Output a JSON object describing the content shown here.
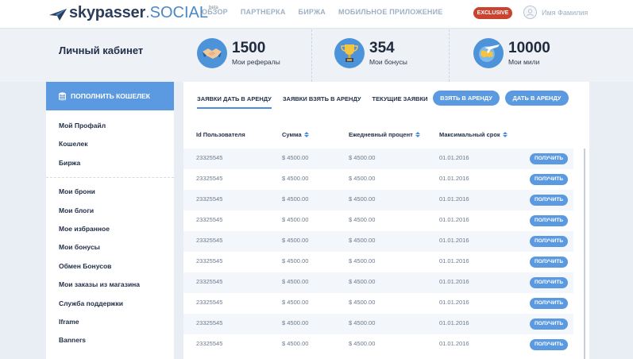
{
  "header": {
    "brand": "skypasser",
    "brand_suffix": ".SOCIAL",
    "beta": "beta",
    "nav": [
      "ОБЗОР",
      "ПАРТНЕРКА",
      "БИРЖА",
      "МОБИЛЬНОЕ ПРИЛОЖЕНИЕ"
    ],
    "exclusive": "EXCLUSIVE",
    "user_name": "Имя Фамилия"
  },
  "page_title": "Личный кабинет",
  "stats": [
    {
      "value": "1500",
      "label": "Мои рефералы",
      "icon": "handshake-icon"
    },
    {
      "value": "354",
      "label": "Мои бонусы",
      "icon": "trophy-icon"
    },
    {
      "value": "10000",
      "label": "Мои мили",
      "icon": "globe-plane-icon"
    }
  ],
  "sidebar": {
    "wallet_button": "ПОПОЛНИТЬ КОШЕЛЕК",
    "group1": [
      "Мой Профайл",
      "Кошелек",
      "Биржа"
    ],
    "group2": [
      "Мои брони",
      "Мои блоги",
      "Мое избранное",
      "Мои бонусы",
      "Обмен Бонусов",
      "Мои заказы из магазина",
      "Служба поддержки",
      "Iframe",
      "Banners"
    ]
  },
  "main": {
    "tabs": [
      "ЗАЯВКИ ДАТЬ В АРЕНДУ",
      "ЗАЯВКИ ВЗЯТЬ В АРЕНДУ",
      "ТЕКУЩИЕ ЗАЯВКИ"
    ],
    "btn_take": "ВЗЯТЬ В АРЕНДУ",
    "btn_give": "ДАТЬ В АРЕНДУ",
    "columns": [
      "Id Пользователя",
      "Сумма",
      "Ежедневный процент",
      "Максимальный срок"
    ],
    "rows": [
      {
        "id": "23325545",
        "sum": "$ 4500.00",
        "percent": "$ 4500.00",
        "term": "01.01.2016",
        "action": "ПОЛУЧИТЬ"
      },
      {
        "id": "23325545",
        "sum": "$ 4500.00",
        "percent": "$ 4500.00",
        "term": "01.01.2016",
        "action": "ПОЛУЧИТЬ"
      },
      {
        "id": "23325545",
        "sum": "$ 4500.00",
        "percent": "$ 4500.00",
        "term": "01.01.2016",
        "action": "ПОЛУЧИТЬ"
      },
      {
        "id": "23325545",
        "sum": "$ 4500.00",
        "percent": "$ 4500.00",
        "term": "01.01.2016",
        "action": "ПОЛУЧИТЬ"
      },
      {
        "id": "23325545",
        "sum": "$ 4500.00",
        "percent": "$ 4500.00",
        "term": "01.01.2016",
        "action": "ПОЛУЧИТЬ"
      },
      {
        "id": "23325545",
        "sum": "$ 4500.00",
        "percent": "$ 4500.00",
        "term": "01.01.2016",
        "action": "ПОЛУЧИТЬ"
      },
      {
        "id": "23325545",
        "sum": "$ 4500.00",
        "percent": "$ 4500.00",
        "term": "01.01.2016",
        "action": "ПОЛУЧИТЬ"
      },
      {
        "id": "23325545",
        "sum": "$ 4500.00",
        "percent": "$ 4500.00",
        "term": "01.01.2016",
        "action": "ПОЛУЧИТЬ"
      },
      {
        "id": "23325545",
        "sum": "$ 4500.00",
        "percent": "$ 4500.00",
        "term": "01.01.2016",
        "action": "ПОЛУЧИТЬ"
      },
      {
        "id": "23325545",
        "sum": "$ 4500.00",
        "percent": "$ 4500.00",
        "term": "01.01.2016",
        "action": "ПОЛУЧИТЬ"
      }
    ]
  },
  "colors": {
    "accent": "#5b9ae0",
    "exclusive": "#c9432f",
    "title": "#23304a"
  }
}
